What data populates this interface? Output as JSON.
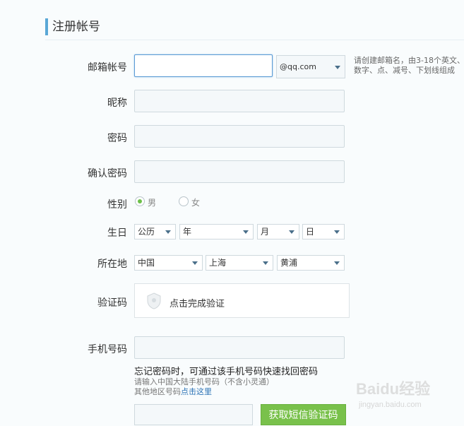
{
  "header": {
    "title": "注册帐号"
  },
  "form": {
    "email": {
      "label": "邮箱帐号",
      "value": "",
      "domain": "@qq.com",
      "tip": "请创建邮箱名，由3-18个英文、数字、点、减号、下划线组成"
    },
    "nickname": {
      "label": "昵称",
      "value": ""
    },
    "password": {
      "label": "密码",
      "value": ""
    },
    "confirm": {
      "label": "确认密码",
      "value": ""
    },
    "gender": {
      "label": "性别",
      "options": [
        "男",
        "女"
      ],
      "selected": "男"
    },
    "birthday": {
      "label": "生日",
      "calendar": "公历",
      "year": "年",
      "month": "月",
      "day": "日"
    },
    "location": {
      "label": "所在地",
      "country": "中国",
      "province": "上海",
      "district": "黄浦"
    },
    "captcha": {
      "label": "验证码",
      "text": "点击完成验证"
    },
    "phone": {
      "label": "手机号码",
      "value": "",
      "hint": "忘记密码时，可通过该手机号码快速找回密码",
      "sub1": "请输入中国大陆手机号码（不含小灵通）",
      "sub2_prefix": "其他地区号码",
      "sub2_link": "点击这里"
    },
    "sms": {
      "button": "获取短信验证码",
      "value": ""
    }
  },
  "watermark": {
    "text": "Baidu经验",
    "url_text": "jingyan.baidu.com"
  },
  "colors": {
    "accent": "#5aa8d6",
    "green": "#79c14b",
    "link": "#2a72b5"
  }
}
